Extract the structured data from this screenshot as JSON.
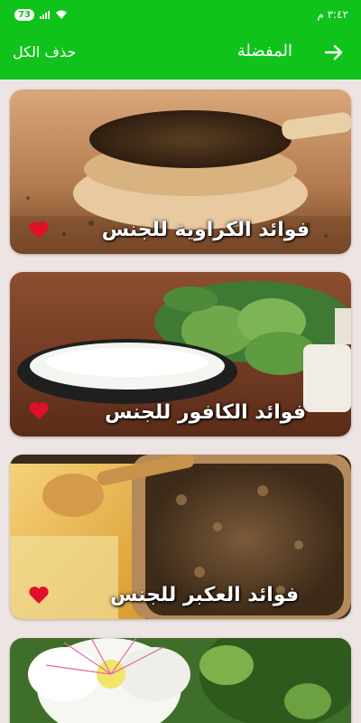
{
  "status_bar": {
    "time": "٣:٤٢ م",
    "battery": "73"
  },
  "app_bar": {
    "title": "المفضلة",
    "delete_all": "حذف الكل",
    "back_icon": "arrow-right-icon"
  },
  "favorites": [
    {
      "label": "فوائد الكراوية للجنس",
      "favorited": true,
      "heart_color": "#e0102b"
    },
    {
      "label": "فوائد الكافور للجنس",
      "favorited": true,
      "heart_color": "#e0102b"
    },
    {
      "label": "فوائد العكبر للجنس",
      "favorited": true,
      "heart_color": "#e0102b"
    }
  ],
  "colors": {
    "primary": "#10c31a",
    "background": "#ede4e4",
    "heart": "#e0102b"
  }
}
